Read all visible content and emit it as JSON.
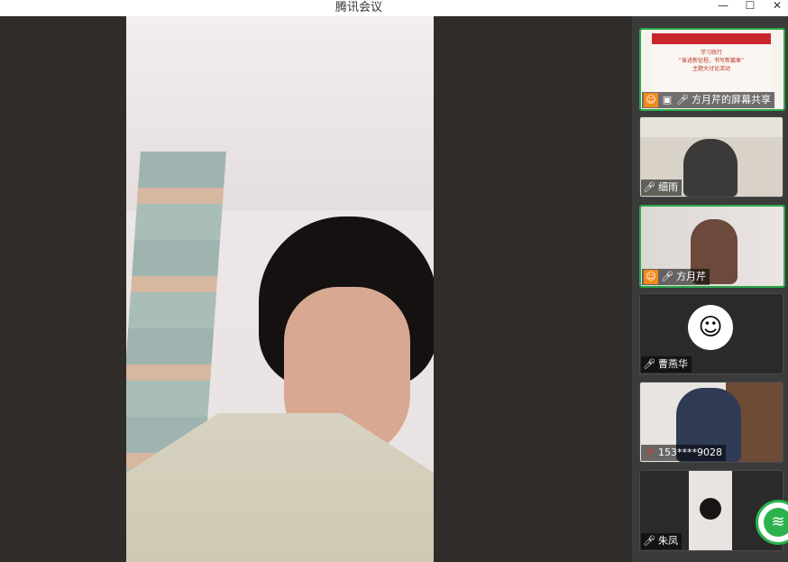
{
  "window": {
    "title": "腾讯会议",
    "minimize": "—",
    "maximize": "☐",
    "close": "✕"
  },
  "participants": [
    {
      "name": "方月芹的屏幕共享",
      "share_lines": [
        "学习践行",
        "“奋进新征程，书写新篇章”",
        "主题大讨论活动"
      ]
    },
    {
      "name": "细雨"
    },
    {
      "name": "方月芹"
    },
    {
      "name": "曹燕华"
    },
    {
      "name": "153****9028"
    },
    {
      "name": "朱凤"
    }
  ],
  "icons": {
    "host": "person-icon",
    "mic": "microphone-icon",
    "screen": "screen-share-icon",
    "muted": "muted-mic-icon",
    "network": "wifi-icon"
  },
  "colors": {
    "active_border": "#2ba84a",
    "host_badge": "#f08c1e",
    "network": "#2bb24c"
  }
}
